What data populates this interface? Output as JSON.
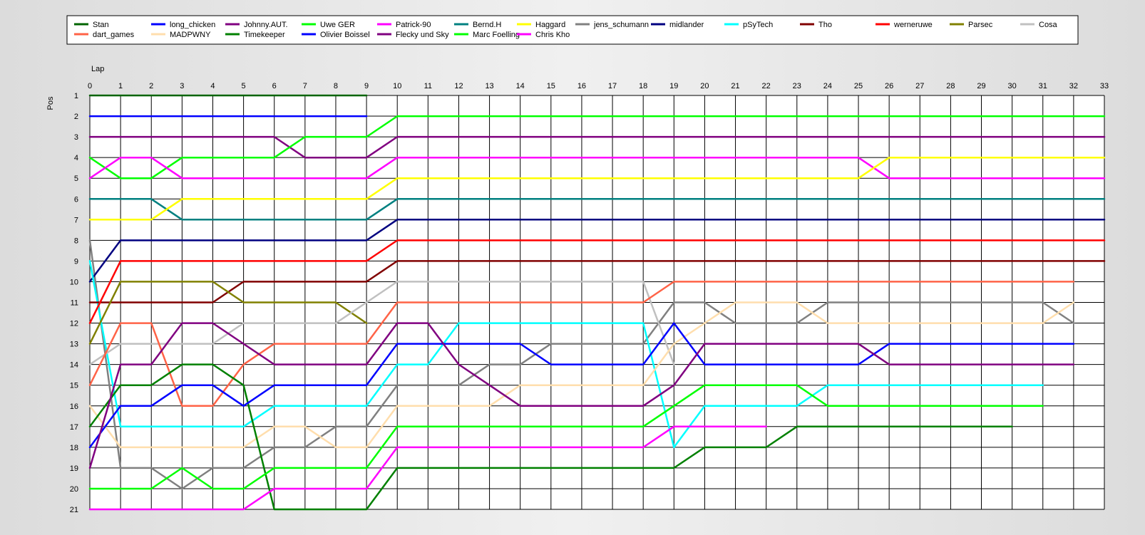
{
  "chart_data": {
    "type": "line",
    "xlabel": "Lap",
    "ylabel": "Pos",
    "xlim": [
      0,
      33
    ],
    "ylim": [
      1,
      21
    ],
    "y_inverted": true,
    "grid": true,
    "legend_position": "top",
    "x": [
      0,
      1,
      2,
      3,
      4,
      5,
      6,
      7,
      8,
      9,
      10,
      11,
      12,
      13,
      14,
      15,
      16,
      17,
      18,
      19,
      20,
      21,
      22,
      23,
      24,
      25,
      26,
      27,
      28,
      29,
      30,
      31,
      32,
      33
    ],
    "series": [
      {
        "name": "Stan",
        "color": "#006400",
        "values": [
          1,
          1,
          1,
          1,
          1,
          1,
          1,
          1,
          1,
          1
        ]
      },
      {
        "name": "long_chicken",
        "color": "#0000ff",
        "values": [
          2,
          2,
          2,
          2,
          2,
          2,
          2,
          2,
          2,
          2
        ]
      },
      {
        "name": "Johnny.AUT.",
        "color": "#800080",
        "values": [
          3,
          3,
          3,
          3,
          3,
          3,
          3,
          4,
          4,
          4,
          3,
          3,
          3,
          3,
          3,
          3,
          3,
          3,
          3,
          3,
          3,
          3,
          3,
          3,
          3,
          3,
          3,
          3,
          3,
          3,
          3,
          3,
          3,
          3
        ]
      },
      {
        "name": "Uwe GER",
        "color": "#00ff00",
        "values": [
          4,
          5,
          5,
          4,
          4,
          4,
          4,
          3,
          3,
          3,
          2,
          2,
          2,
          2,
          2,
          2,
          2,
          2,
          2,
          2,
          2,
          2,
          2,
          2,
          2,
          2,
          2,
          2,
          2,
          2,
          2,
          2,
          2,
          2
        ]
      },
      {
        "name": "Patrick-90",
        "color": "#ff00ff",
        "values": [
          5,
          4,
          4,
          5,
          5,
          5,
          5,
          5,
          5,
          5,
          4,
          4,
          4,
          4,
          4,
          4,
          4,
          4,
          4,
          4,
          4,
          4,
          4,
          4,
          4,
          4,
          5,
          5,
          5,
          5,
          5,
          5,
          5,
          5
        ]
      },
      {
        "name": "Bernd.H",
        "color": "#008080",
        "values": [
          6,
          6,
          6,
          7,
          7,
          7,
          7,
          7,
          7,
          7,
          6,
          6,
          6,
          6,
          6,
          6,
          6,
          6,
          6,
          6,
          6,
          6,
          6,
          6,
          6,
          6,
          6,
          6,
          6,
          6,
          6,
          6,
          6,
          6
        ]
      },
      {
        "name": "Haggard",
        "color": "#ffff00",
        "values": [
          7,
          7,
          7,
          6,
          6,
          6,
          6,
          6,
          6,
          6,
          5,
          5,
          5,
          5,
          5,
          5,
          5,
          5,
          5,
          5,
          5,
          5,
          5,
          5,
          5,
          5,
          4,
          4,
          4,
          4,
          4,
          4,
          4,
          4
        ]
      },
      {
        "name": "jens_schumann",
        "color": "#808080",
        "values": [
          8,
          19,
          19,
          20,
          19,
          19,
          18,
          18,
          17,
          17,
          15,
          15,
          15,
          14,
          14,
          13,
          13,
          13,
          13,
          11,
          11,
          12,
          12,
          12,
          11,
          11,
          11,
          11,
          11,
          11,
          11,
          11,
          12
        ]
      },
      {
        "name": "midlander",
        "color": "#000080",
        "values": [
          10,
          8,
          8,
          8,
          8,
          8,
          8,
          8,
          8,
          8,
          7,
          7,
          7,
          7,
          7,
          7,
          7,
          7,
          7,
          7,
          7,
          7,
          7,
          7,
          7,
          7,
          7,
          7,
          7,
          7,
          7,
          7,
          7,
          7
        ]
      },
      {
        "name": "pSyTech",
        "color": "#00ffff",
        "values": [
          9,
          17,
          17,
          17,
          17,
          17,
          16,
          16,
          16,
          16,
          14,
          14,
          12,
          12,
          12,
          12,
          12,
          12,
          12,
          18,
          16,
          16,
          16,
          16,
          15,
          15,
          15,
          15,
          15,
          15,
          15,
          15
        ]
      },
      {
        "name": "Tho",
        "color": "#800000",
        "values": [
          11,
          11,
          11,
          11,
          11,
          10,
          10,
          10,
          10,
          10,
          9,
          9,
          9,
          9,
          9,
          9,
          9,
          9,
          9,
          9,
          9,
          9,
          9,
          9,
          9,
          9,
          9,
          9,
          9,
          9,
          9,
          9,
          9,
          9
        ]
      },
      {
        "name": "werneruwe",
        "color": "#ff0000",
        "values": [
          12,
          9,
          9,
          9,
          9,
          9,
          9,
          9,
          9,
          9,
          8,
          8,
          8,
          8,
          8,
          8,
          8,
          8,
          8,
          8,
          8,
          8,
          8,
          8,
          8,
          8,
          8,
          8,
          8,
          8,
          8,
          8,
          8,
          8
        ]
      },
      {
        "name": "Parsec",
        "color": "#808000",
        "values": [
          13,
          10,
          10,
          10,
          10,
          11,
          11,
          11,
          11,
          12
        ]
      },
      {
        "name": "Cosa",
        "color": "#c0c0c0",
        "values": [
          14,
          13,
          13,
          13,
          13,
          12,
          12,
          12,
          12,
          11,
          10,
          10,
          10,
          10,
          10,
          10,
          10,
          10,
          10,
          14
        ]
      },
      {
        "name": "dart_games",
        "color": "#ff6347",
        "values": [
          15,
          12,
          12,
          16,
          16,
          14,
          13,
          13,
          13,
          13,
          11,
          11,
          11,
          11,
          11,
          11,
          11,
          11,
          11,
          10,
          10,
          10,
          10,
          10,
          10,
          10,
          10,
          10,
          10,
          10,
          10,
          10,
          10
        ]
      },
      {
        "name": "MADPWNY",
        "color": "#ffdead",
        "values": [
          16,
          18,
          18,
          18,
          18,
          18,
          17,
          17,
          18,
          18,
          16,
          16,
          16,
          16,
          15,
          15,
          15,
          15,
          15,
          13,
          12,
          11,
          11,
          11,
          12,
          12,
          12,
          12,
          12,
          12,
          12,
          12,
          11
        ]
      },
      {
        "name": "Timekeeper",
        "color": "#008000",
        "values": [
          17,
          15,
          15,
          14,
          14,
          15,
          21,
          21,
          21,
          21,
          19,
          19,
          19,
          19,
          19,
          19,
          19,
          19,
          19,
          19,
          18,
          18,
          18,
          17,
          17,
          17,
          17,
          17,
          17,
          17,
          17
        ]
      },
      {
        "name": "Olivier Boissel",
        "color": "#0000ff",
        "values": [
          18,
          16,
          16,
          15,
          15,
          16,
          15,
          15,
          15,
          15,
          13,
          13,
          13,
          13,
          13,
          14,
          14,
          14,
          14,
          12,
          14,
          14,
          14,
          14,
          14,
          14,
          13,
          13,
          13,
          13,
          13,
          13,
          13
        ]
      },
      {
        "name": "Flecky und Sky",
        "color": "#800080",
        "values": [
          19,
          14,
          14,
          12,
          12,
          13,
          14,
          14,
          14,
          14,
          12,
          12,
          14,
          15,
          16,
          16,
          16,
          16,
          16,
          15,
          13,
          13,
          13,
          13,
          13,
          13,
          14,
          14,
          14,
          14,
          14,
          14,
          14
        ]
      },
      {
        "name": "Marc Foelling",
        "color": "#00ff00",
        "values": [
          20,
          20,
          20,
          19,
          20,
          20,
          19,
          19,
          19,
          19,
          17,
          17,
          17,
          17,
          17,
          17,
          17,
          17,
          17,
          16,
          15,
          15,
          15,
          15,
          16,
          16,
          16,
          16,
          16,
          16,
          16,
          16
        ]
      },
      {
        "name": "Chris Kho",
        "color": "#ff00ff",
        "values": [
          21,
          21,
          21,
          21,
          21,
          21,
          20,
          20,
          20,
          20,
          18,
          18,
          18,
          18,
          18,
          18,
          18,
          18,
          18,
          17,
          17,
          17,
          17
        ]
      }
    ]
  }
}
